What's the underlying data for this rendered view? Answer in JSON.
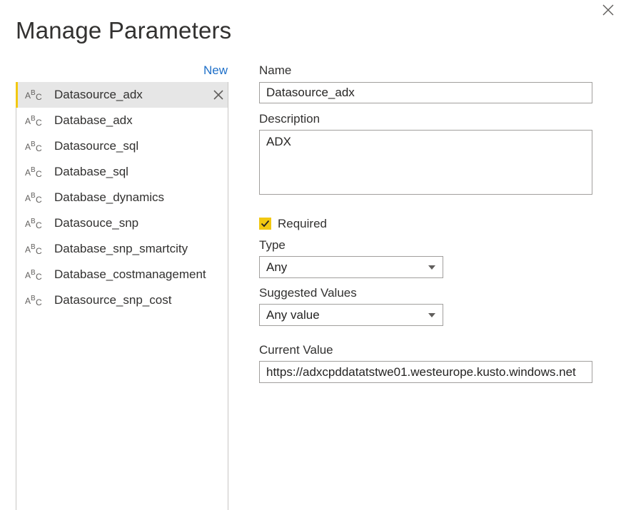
{
  "dialog": {
    "title": "Manage Parameters",
    "new_label": "New"
  },
  "parameters": [
    {
      "label": "Datasource_adx",
      "type_icon": "text-type-icon",
      "selected": true
    },
    {
      "label": "Database_adx",
      "type_icon": "text-type-icon",
      "selected": false
    },
    {
      "label": "Datasource_sql",
      "type_icon": "text-type-icon",
      "selected": false
    },
    {
      "label": "Database_sql",
      "type_icon": "text-type-icon",
      "selected": false
    },
    {
      "label": "Database_dynamics",
      "type_icon": "text-type-icon",
      "selected": false
    },
    {
      "label": "Datasouce_snp",
      "type_icon": "text-type-icon",
      "selected": false
    },
    {
      "label": "Database_snp_smartcity",
      "type_icon": "text-type-icon",
      "selected": false
    },
    {
      "label": "Database_costmanagement",
      "type_icon": "text-type-icon",
      "selected": false
    },
    {
      "label": "Datasource_snp_cost",
      "type_icon": "text-type-icon",
      "selected": false
    }
  ],
  "form": {
    "name_label": "Name",
    "name_value": "Datasource_adx",
    "description_label": "Description",
    "description_value": "ADX",
    "required_label": "Required",
    "required_checked": true,
    "type_label": "Type",
    "type_value": "Any",
    "suggested_label": "Suggested Values",
    "suggested_value": "Any value",
    "current_value_label": "Current Value",
    "current_value": "https://adxcpddatatstwe01.westeurope.kusto.windows.net"
  },
  "colors": {
    "accent": "#f2c811",
    "link": "#1e6fc8",
    "selected_bg": "#e6e6e6",
    "border": "#a19f9d"
  }
}
